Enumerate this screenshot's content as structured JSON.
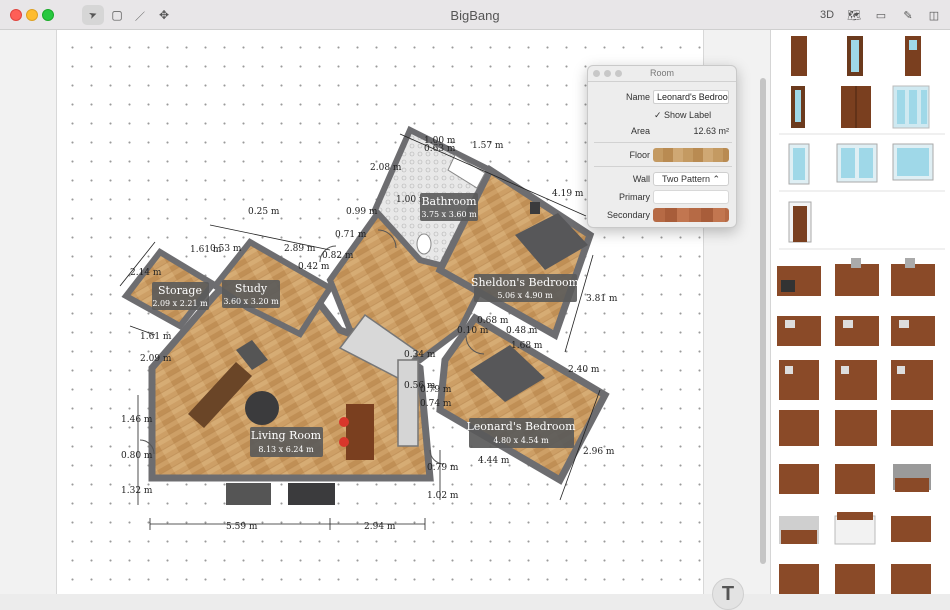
{
  "window": {
    "title": "BigBang"
  },
  "toolbar": {
    "tools": [
      {
        "name": "select-tool-icon",
        "glyph": "➤"
      },
      {
        "name": "rectangle-tool-icon",
        "glyph": "▢"
      },
      {
        "name": "line-tool-icon",
        "glyph": "／"
      },
      {
        "name": "move-tool-icon",
        "glyph": "✥"
      }
    ],
    "right": [
      {
        "name": "3d-view-button",
        "label": "3D"
      },
      {
        "name": "map-icon",
        "label": "🗺"
      },
      {
        "name": "ruler-icon",
        "label": "▭"
      },
      {
        "name": "paint-brush-icon",
        "label": "✎"
      },
      {
        "name": "sidebar-toggle-icon",
        "label": "◫"
      }
    ]
  },
  "rooms": [
    {
      "name": "Bathroom",
      "size": "3.75 x 3.60 m"
    },
    {
      "name": "Storage",
      "size": "2.09 x 2.21 m"
    },
    {
      "name": "Study",
      "size": "3.60 x 3.20 m"
    },
    {
      "name": "Sheldon's Bedroom",
      "size": "5.06 x 4.90 m"
    },
    {
      "name": "Living Room",
      "size": "8.13 x 6.24 m"
    },
    {
      "name": "Leonard's Bedroom",
      "size": "4.80 x 4.54 m"
    }
  ],
  "dimensions": [
    "1.00 m",
    "0.63 m",
    "1.57 m",
    "2.08 m",
    "4.19 m",
    "1.00 m",
    "0.99 m",
    "0.25 m",
    "0.71 m",
    "1.61 m",
    "0.53 m",
    "2.89 m",
    "0.82 m",
    "0.42 m",
    "2.14 m",
    "1.61 m",
    "2.09 m",
    "0.10 m",
    "0.68 m",
    "0.48 m",
    "1.68 m",
    "3.81 m",
    "0.34 m",
    "0.56 m",
    "0.79 m",
    "0.74 m",
    "2.40 m",
    "1.46 m",
    "0.80 m",
    "1.32 m",
    "0.79 m",
    "1.02 m",
    "4.44 m",
    "2.96 m",
    "5.59 m",
    "2.94 m"
  ],
  "panel": {
    "title": "Room",
    "name_label": "Name",
    "name_value": "Leonard's Bedroom",
    "show_label": "Show Label",
    "area_label": "Area",
    "area_value": "12.63 m²",
    "floor_label": "Floor",
    "wall_label": "Wall",
    "wall_value": "Two Pattern",
    "primary_label": "Primary",
    "secondary_label": "Secondary"
  },
  "fab": {
    "glyph": "T"
  },
  "colors": {
    "wall": "#6d6d70",
    "floor": "#c9995d",
    "door": "#7a3f1f",
    "glass": "#9fd8e8",
    "label_bg": "#5a5a5a"
  }
}
